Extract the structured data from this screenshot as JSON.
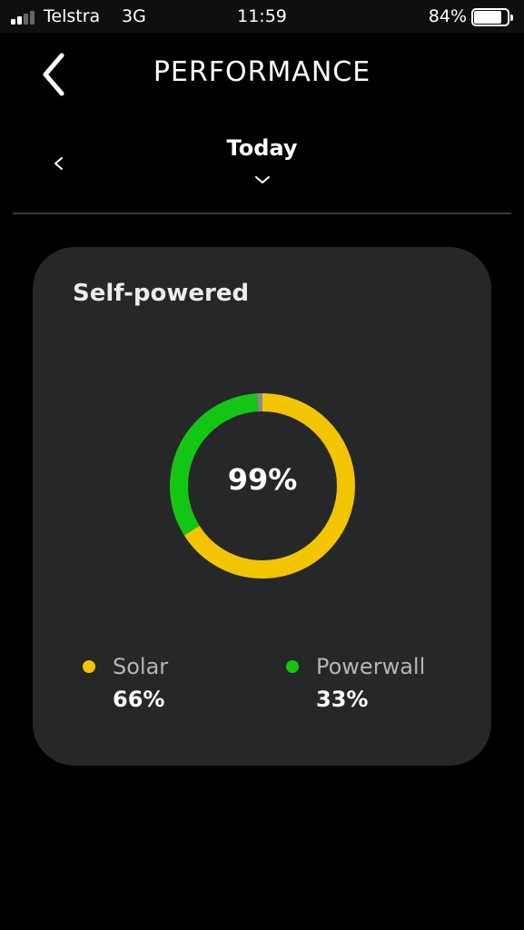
{
  "status_bar": {
    "carrier": "Telstra",
    "network": "3G",
    "time": "11:59",
    "battery_percent": "84%",
    "battery_level": 0.84,
    "signal_bars": 2
  },
  "header": {
    "title": "PERFORMANCE",
    "back_icon": "chevron-left-icon"
  },
  "period": {
    "label": "Today",
    "prev_icon": "chevron-left-icon",
    "dropdown_icon": "chevron-down-icon"
  },
  "card": {
    "title": "Self-powered",
    "total": "99%",
    "donut": {
      "gap_fraction": 0.01,
      "segments": [
        {
          "name": "Solar",
          "fraction": 0.66,
          "color": "#f2c500"
        },
        {
          "name": "Powerwall",
          "fraction": 0.33,
          "color": "#14c614"
        }
      ],
      "gap_color": "#8a8a8a"
    },
    "legend": [
      {
        "name": "Solar",
        "value": "66%",
        "color": "#f2c500"
      },
      {
        "name": "Powerwall",
        "value": "33%",
        "color": "#14c614"
      }
    ]
  }
}
